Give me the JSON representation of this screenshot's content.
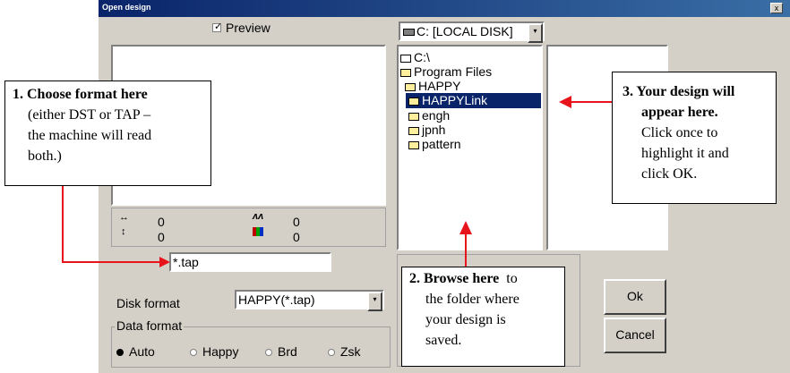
{
  "window": {
    "title": "Open design",
    "close_label": "x"
  },
  "preview": {
    "label": "Preview",
    "checked": true
  },
  "drive": {
    "value": "C: [LOCAL DISK]"
  },
  "tree": {
    "items": [
      {
        "label": "C:\\"
      },
      {
        "label": "Program Files"
      },
      {
        "label": "HAPPY"
      },
      {
        "label": "HAPPYLink",
        "selected": true
      },
      {
        "label": "engh"
      },
      {
        "label": "jpnh"
      },
      {
        "label": "pattern"
      }
    ]
  },
  "stats": {
    "width_value": "0",
    "height_value": "0",
    "stitches_value": "0",
    "colors_value": "0"
  },
  "filter": {
    "value": "*.tap"
  },
  "disk_format": {
    "label": "Disk format",
    "value": "HAPPY(*.tap)"
  },
  "data_format": {
    "label": "Data format",
    "options": [
      {
        "label": "Auto",
        "selected": true
      },
      {
        "label": "Happy",
        "selected": false
      },
      {
        "label": "Brd",
        "selected": false
      },
      {
        "label": "Zsk",
        "selected": false
      }
    ]
  },
  "buttons": {
    "ok_label": "Ok",
    "cancel_label": "Cancel"
  },
  "callouts": {
    "format": {
      "bold": "1.  Choose format here",
      "lines": [
        "(either DST or TAP –",
        "the machine will read",
        "both.)"
      ]
    },
    "design": {
      "bold_lines": [
        "3.  Your design will",
        "appear here."
      ],
      "lines": [
        "Click once to",
        "highlight it and",
        "click OK."
      ]
    },
    "browse": {
      "bold": "2.  Browse here",
      "first_rest": "to",
      "lines": [
        "the folder where",
        "your design is",
        "saved."
      ]
    }
  },
  "colors": {
    "selection": "#0a246a",
    "arrow": "#e8141c"
  }
}
